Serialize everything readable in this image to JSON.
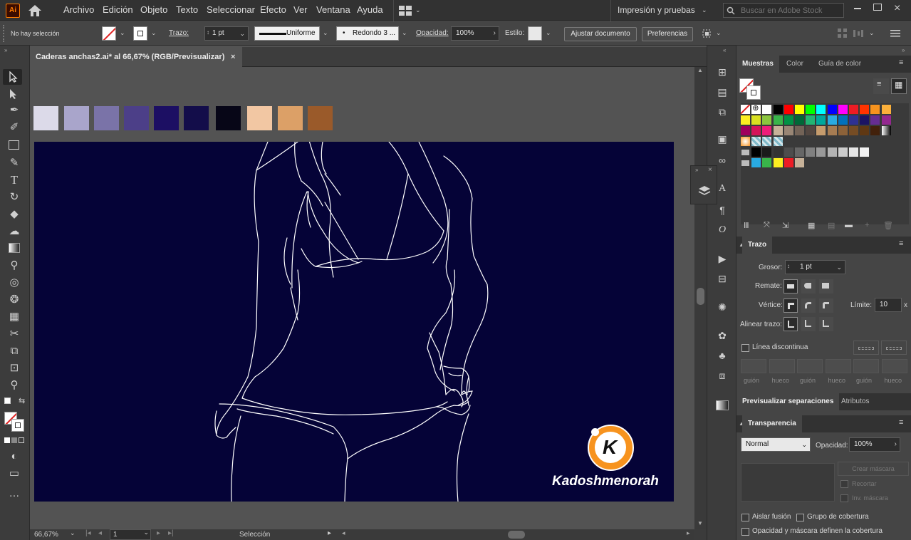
{
  "app": {
    "logo": "Ai"
  },
  "menu": [
    "Archivo",
    "Edición",
    "Objeto",
    "Texto",
    "Seleccionar",
    "Efecto",
    "Ver",
    "Ventana",
    "Ayuda"
  ],
  "workspace": "Impresión y pruebas",
  "search": {
    "placeholder": "Buscar en Adobe Stock"
  },
  "control": {
    "selection": "No hay selección",
    "stroke_label": "Trazo:",
    "stroke_value": "1 pt",
    "profile": "Uniforme",
    "brush": "Redondo 3 ...",
    "opacity_label": "Opacidad:",
    "opacity_value": "100%",
    "style_label": "Estilo:",
    "fit_button": "Ajustar documento",
    "prefs_button": "Preferencias"
  },
  "document": {
    "tab_title": "Caderas anchas2.ai* al 66,67% (RGB/Previsualizar)",
    "close": "×"
  },
  "palette_swatches": [
    "#dcdae9",
    "#a9a5cb",
    "#7a73a8",
    "#4c3f88",
    "#1c0f63",
    "#130d4a",
    "#070617",
    "#f2c7a3",
    "#dca067",
    "#9a5a2a"
  ],
  "canvas": {
    "background": "#050337",
    "stroke": "#ffffff"
  },
  "watermark": {
    "letter": "K",
    "text": "Kadoshmenorah",
    "accent": "#f7931e"
  },
  "status": {
    "zoom": "66,67%",
    "artboard": "1",
    "mode": "Selección"
  },
  "panels": {
    "swatches_tabs": [
      "Muestras",
      "Color",
      "Guía de color"
    ],
    "swatch_rows": [
      [
        "none",
        "reg",
        "#ffffff",
        "#000000",
        "#ff0000",
        "#ffff00",
        "#00ff00",
        "#00ffff",
        "#0000ff",
        "#ff00ff",
        "#ed1c24",
        "#ff3300",
        "#f7931e",
        "#fbb03b"
      ],
      [
        "#fcee21",
        "#d9e021",
        "#8cc63f",
        "#39b54a",
        "#009245",
        "#006837",
        "#22b573",
        "#00a99d",
        "#29abe2",
        "#0071bc",
        "#2e3192",
        "#1b1464",
        "#662d91",
        "#93278f"
      ],
      [
        "#9e005d",
        "#d4145a",
        "#ed1e79",
        "#c7b299",
        "#998675",
        "#736357",
        "#534741",
        "#c69c6d",
        "#a67c52",
        "#8c6239",
        "#754c24",
        "#603813",
        "#42210b",
        "grad"
      ],
      [
        "grad2",
        "pat1",
        "pat2",
        "pat3"
      ],
      [
        "folder",
        "#000000",
        "#1a1a1a",
        "#333333",
        "#4d4d4d",
        "#666666",
        "#808080",
        "#999999",
        "#b3b3b3",
        "#cccccc",
        "#e6e6e6",
        "#f2f2f2"
      ],
      [
        "folder",
        "#29abe2",
        "#39b54a",
        "#fcee21",
        "#ed1c24",
        "#c7b299"
      ]
    ],
    "stroke": {
      "title": "Trazo",
      "weight_label": "Grosor:",
      "weight_value": "1 pt",
      "cap_label": "Remate:",
      "corner_label": "Vértice:",
      "limit_label": "Límite:",
      "limit_value": "10",
      "limit_unit": "x",
      "align_label": "Alinear trazo:",
      "dashed_label": "Línea discontinua",
      "dash_labels": [
        "guión",
        "hueco",
        "guión",
        "hueco",
        "guión",
        "hueco"
      ]
    },
    "sep_tabs": [
      "Previsualizar separaciones",
      "Atributos"
    ],
    "transparency": {
      "title": "Transparencia",
      "mode": "Normal",
      "opacity_label": "Opacidad:",
      "opacity_value": "100%",
      "mask_button": "Crear máscara",
      "clip_label": "Recortar",
      "invert_label": "Inv. máscara",
      "isolate_label": "Aislar fusión",
      "knockout_label": "Grupo de cobertura",
      "define_label": "Opacidad y máscara definen la cobertura"
    }
  }
}
